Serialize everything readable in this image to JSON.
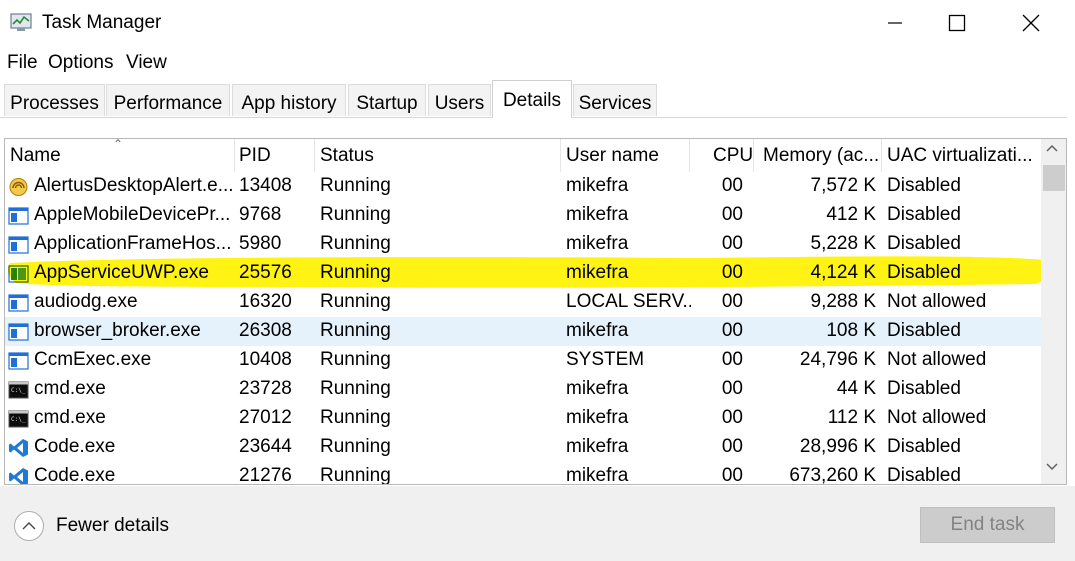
{
  "window": {
    "title": "Task Manager"
  },
  "menu": [
    "File",
    "Options",
    "View"
  ],
  "tabs": [
    {
      "label": "Processes"
    },
    {
      "label": "Performance"
    },
    {
      "label": "App history"
    },
    {
      "label": "Startup"
    },
    {
      "label": "Users"
    },
    {
      "label": "Details",
      "active": true
    },
    {
      "label": "Services"
    }
  ],
  "columns": [
    "Name",
    "PID",
    "Status",
    "User name",
    "CPU",
    "Memory (ac...",
    "UAC virtualizati..."
  ],
  "rows": [
    {
      "icon": "alert-app-icon",
      "name": "AlertusDesktopAlert.e...",
      "pid": "13408",
      "status": "Running",
      "user": "mikefra",
      "cpu": "00",
      "mem": "7,572 K",
      "uac": "Disabled"
    },
    {
      "icon": "window-app-icon",
      "name": "AppleMobileDevicePr...",
      "pid": "9768",
      "status": "Running",
      "user": "mikefra",
      "cpu": "00",
      "mem": "412 K",
      "uac": "Disabled"
    },
    {
      "icon": "window-app-icon",
      "name": "ApplicationFrameHos...",
      "pid": "5980",
      "status": "Running",
      "user": "mikefra",
      "cpu": "00",
      "mem": "5,228 K",
      "uac": "Disabled"
    },
    {
      "icon": "uwp-app-icon",
      "name": "AppServiceUWP.exe",
      "pid": "25576",
      "status": "Running",
      "user": "mikefra",
      "cpu": "00",
      "mem": "4,124 K",
      "uac": "Disabled"
    },
    {
      "icon": "window-app-icon",
      "name": "audiodg.exe",
      "pid": "16320",
      "status": "Running",
      "user": "LOCAL SERV...",
      "cpu": "00",
      "mem": "9,288 K",
      "uac": "Not allowed"
    },
    {
      "icon": "window-app-icon",
      "name": "browser_broker.exe",
      "pid": "26308",
      "status": "Running",
      "user": "mikefra",
      "cpu": "00",
      "mem": "108 K",
      "uac": "Disabled",
      "hover": true
    },
    {
      "icon": "window-app-icon",
      "name": "CcmExec.exe",
      "pid": "10408",
      "status": "Running",
      "user": "SYSTEM",
      "cpu": "00",
      "mem": "24,796 K",
      "uac": "Not allowed"
    },
    {
      "icon": "console-icon",
      "name": "cmd.exe",
      "pid": "23728",
      "status": "Running",
      "user": "mikefra",
      "cpu": "00",
      "mem": "44 K",
      "uac": "Disabled"
    },
    {
      "icon": "console-icon",
      "name": "cmd.exe",
      "pid": "27012",
      "status": "Running",
      "user": "mikefra",
      "cpu": "00",
      "mem": "112 K",
      "uac": "Not allowed"
    },
    {
      "icon": "vscode-icon",
      "name": "Code.exe",
      "pid": "23644",
      "status": "Running",
      "user": "mikefra",
      "cpu": "00",
      "mem": "28,996 K",
      "uac": "Disabled"
    },
    {
      "icon": "vscode-icon",
      "name": "Code.exe",
      "pid": "21276",
      "status": "Running",
      "user": "mikefra",
      "cpu": "00",
      "mem": "673,260 K",
      "uac": "Disabled"
    }
  ],
  "footer": {
    "fewer_details": "Fewer details",
    "end_task": "End task"
  },
  "colors": {
    "highlight": "#fff200",
    "hover_row": "#e5f1fb",
    "accent_blue": "#1f6fd6"
  }
}
